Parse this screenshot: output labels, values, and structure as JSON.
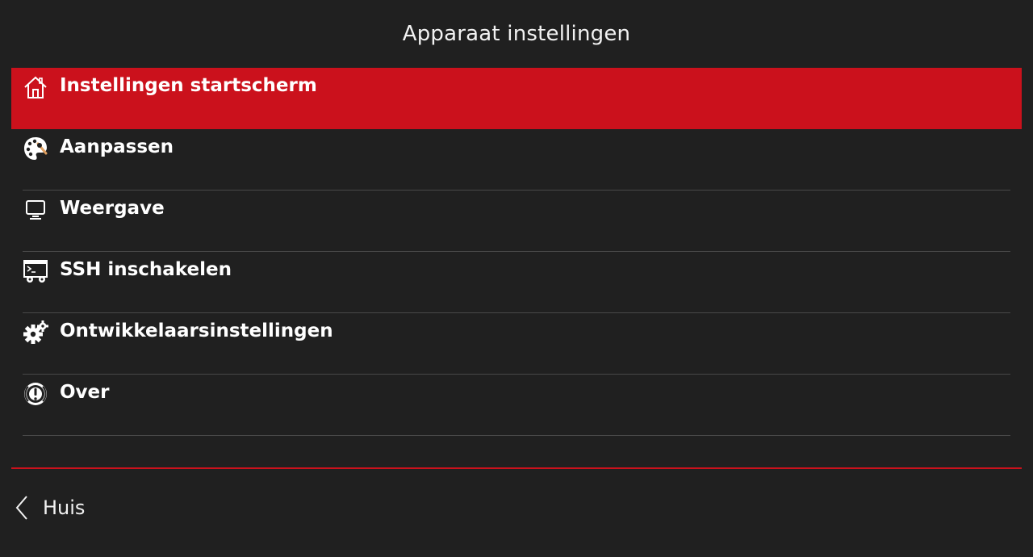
{
  "header": {
    "title": "Apparaat instellingen"
  },
  "menu": {
    "items": [
      {
        "label": "Instellingen startscherm",
        "icon": "home-icon",
        "active": true
      },
      {
        "label": "Aanpassen",
        "icon": "palette-icon",
        "active": false
      },
      {
        "label": "Weergave",
        "icon": "monitor-icon",
        "active": false
      },
      {
        "label": "SSH inschakelen",
        "icon": "terminal-settings-icon",
        "active": false
      },
      {
        "label": "Ontwikkelaarsinstellingen",
        "icon": "gears-icon",
        "active": false
      },
      {
        "label": "Over",
        "icon": "info-icon",
        "active": false
      }
    ]
  },
  "footer": {
    "back_label": "Huis",
    "back_icon": "chevron-left-icon"
  },
  "colors": {
    "background": "#202020",
    "accent": "#cb111c",
    "separator": "#484848",
    "text": "#ffffff"
  }
}
